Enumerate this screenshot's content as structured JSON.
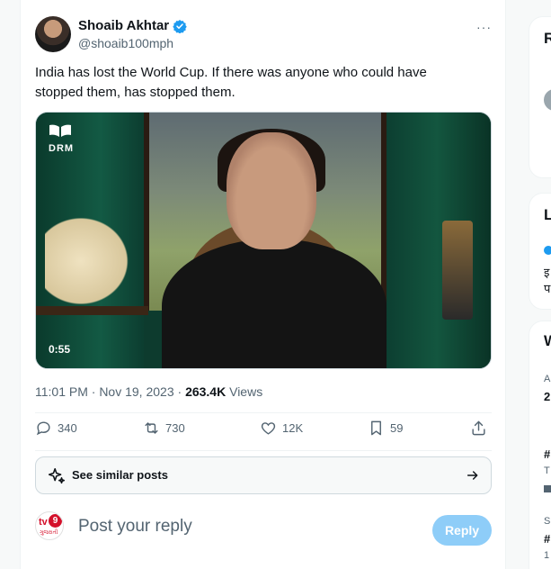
{
  "post": {
    "author_name": "Shoaib Akhtar",
    "author_handle": "@shoaib100mph",
    "more_label": "···",
    "text": "India has lost the World Cup. If there was anyone who could have stopped them, has stopped them.",
    "video": {
      "watermark": "DRM",
      "duration": "0:55"
    },
    "timestamp": "11:01 PM · Nov 19, 2023 · ",
    "views_count": "263.4K",
    "views_label": " Views",
    "actions": {
      "replies": "340",
      "reposts": "730",
      "likes": "12K",
      "bookmarks": "59"
    }
  },
  "similar_posts": {
    "label": "See similar posts"
  },
  "reply": {
    "avatar_text": "tv",
    "avatar_badge": "9",
    "avatar_sub": "ગુજરાતી",
    "placeholder": "Post your reply",
    "button_label": "Reply"
  },
  "sidebar": {
    "card1_initial": "R",
    "card2_initial": "L",
    "card2_line1": "इ",
    "card2_line2": "प",
    "card3_initial": "W",
    "card3_a": "A",
    "card3_2": "2",
    "card3_hash1": "#",
    "card3_t": "T",
    "card3_s": "S",
    "card3_hash2": "#",
    "card3_1": "1"
  },
  "colors": {
    "accent": "#1d9bf0",
    "reply_button": "#8ecdf8",
    "muted_text": "#536471"
  }
}
